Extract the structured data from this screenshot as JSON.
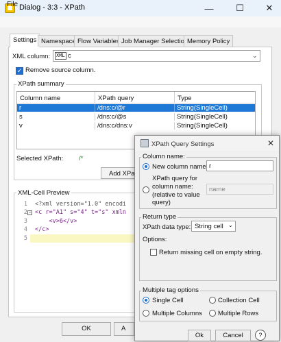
{
  "window": {
    "title": "Dialog - 3:3 - XPath",
    "minimize_glyph": "—",
    "maximize_glyph": "☐",
    "close_glyph": "✕"
  },
  "menu": {
    "file": "File"
  },
  "tabs": [
    "Settings",
    "Namespace",
    "Flow Variables",
    "Job Manager Selection",
    "Memory Policy"
  ],
  "settings": {
    "xml_column_label": "XML column:",
    "xml_badge": "XML",
    "xml_column_value": "c",
    "remove_source_label": "Remove source column.",
    "remove_source_checked": true
  },
  "xpath_summary": {
    "label": "XPath summary",
    "columns": [
      "Column name",
      "XPath query",
      "Type"
    ],
    "rows": [
      [
        "r",
        "/dns:c/@r",
        "String(SingleCell)"
      ],
      [
        "s",
        "/dns:c/@s",
        "String(SingleCell)"
      ],
      [
        "v",
        "/dns:c/dns:v",
        "String(SingleCell)"
      ]
    ],
    "selected_row": 0,
    "selected_xpath_label": "Selected XPath:",
    "selected_xpath_value": "/*",
    "add_button": "Add XPath"
  },
  "preview": {
    "label": "XML-Cell Preview",
    "line_numbers": [
      "1",
      "2",
      "3",
      "4",
      "5"
    ],
    "lines": [
      "<?xml version=\"1.0\" encodi",
      "<c r=\"A1\" s=\"4\" t=\"s\" xmln",
      "    <v>6</v>",
      "</c>",
      ""
    ]
  },
  "main_buttons": {
    "ok": "OK",
    "apply": "A"
  },
  "dialog": {
    "title": "XPath Query Settings",
    "close_glyph": "✕",
    "column_name": {
      "label": "Column name:",
      "new_column_label": "New column name:",
      "new_column_value": "r",
      "xpath_query_label_1": "XPath query for",
      "xpath_query_label_2": "column name:",
      "xpath_query_label_3": "(relative to value",
      "xpath_query_label_4": "query)",
      "xpath_query_placeholder": "name",
      "selected": "new"
    },
    "return_type": {
      "label": "Return type",
      "datatype_label": "XPath data type:",
      "datatype_value": "String cell",
      "options_label": "Options:",
      "missing_label": "Return missing cell on empty string.",
      "missing_checked": false
    },
    "multiple_tag": {
      "label": "Multiple tag options",
      "options": [
        "Single Cell",
        "Collection Cell",
        "Multiple Columns",
        "Multiple Rows"
      ],
      "selected": 0
    },
    "buttons": {
      "ok": "Ok",
      "cancel": "Cancel",
      "help": "?"
    }
  }
}
